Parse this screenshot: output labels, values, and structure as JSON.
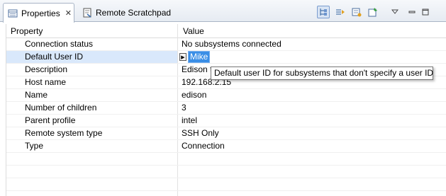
{
  "tabs": [
    {
      "label": "Properties",
      "icon": "properties-icon",
      "active": true
    },
    {
      "label": "Remote Scratchpad",
      "icon": "scratchpad-icon",
      "active": false
    }
  ],
  "toolbar": {
    "buttons": [
      "show-categories-icon",
      "filter-icon",
      "show-advanced-icon",
      "pin-icon",
      "view-menu-icon",
      "minimize-icon",
      "maximize-icon"
    ]
  },
  "table": {
    "columns": [
      "Property",
      "Value"
    ],
    "rows": [
      {
        "property": "Connection status",
        "value": "No subsystems connected"
      },
      {
        "property": "Default User ID",
        "value": "Mike"
      },
      {
        "property": "Description",
        "value": "Edison t"
      },
      {
        "property": "Host name",
        "value": "192.168.2.15"
      },
      {
        "property": "Name",
        "value": "edison"
      },
      {
        "property": "Number of children",
        "value": "3"
      },
      {
        "property": "Parent profile",
        "value": "intel"
      },
      {
        "property": "Remote system type",
        "value": "SSH Only"
      },
      {
        "property": "Type",
        "value": "Connection"
      }
    ]
  },
  "tooltip": "Default user ID for subsystems that don't specify a user ID"
}
